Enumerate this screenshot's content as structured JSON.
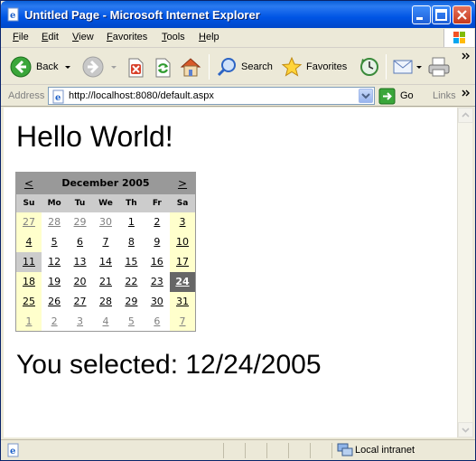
{
  "window": {
    "title": "Untitled Page - Microsoft Internet Explorer"
  },
  "menu": {
    "items": [
      "File",
      "Edit",
      "View",
      "Favorites",
      "Tools",
      "Help"
    ]
  },
  "toolbar": {
    "back_label": "Back",
    "search_label": "Search",
    "favorites_label": "Favorites"
  },
  "address": {
    "label": "Address",
    "url": "http://localhost:8080/default.aspx",
    "go_label": "Go",
    "links_label": "Links"
  },
  "page": {
    "heading": "Hello World!",
    "selected_text": "You selected: 12/24/2005"
  },
  "calendar": {
    "prev": "<",
    "next": ">",
    "month": "December 2005",
    "day_names": [
      "Su",
      "Mo",
      "Tu",
      "We",
      "Th",
      "Fr",
      "Sa"
    ],
    "weeks": [
      [
        "27",
        "28",
        "29",
        "30",
        "1",
        "2",
        "3"
      ],
      [
        "4",
        "5",
        "6",
        "7",
        "8",
        "9",
        "10"
      ],
      [
        "11",
        "12",
        "13",
        "14",
        "15",
        "16",
        "17"
      ],
      [
        "18",
        "19",
        "20",
        "21",
        "22",
        "23",
        "24"
      ],
      [
        "25",
        "26",
        "27",
        "28",
        "29",
        "30",
        "31"
      ],
      [
        "1",
        "2",
        "3",
        "4",
        "5",
        "6",
        "7"
      ]
    ],
    "other_month_cells": [
      [
        0,
        0
      ],
      [
        0,
        1
      ],
      [
        0,
        2
      ],
      [
        0,
        3
      ],
      [
        5,
        0
      ],
      [
        5,
        1
      ],
      [
        5,
        2
      ],
      [
        5,
        3
      ],
      [
        5,
        4
      ],
      [
        5,
        5
      ],
      [
        5,
        6
      ]
    ],
    "today": "11",
    "selected": "24",
    "colors": {
      "title_bg": "#999999",
      "header_bg": "#cccccc",
      "weekend_bg": "#ffffcc",
      "today_bg": "#cccccc",
      "selected_bg": "#666666"
    }
  },
  "status": {
    "zone": "Local intranet"
  }
}
